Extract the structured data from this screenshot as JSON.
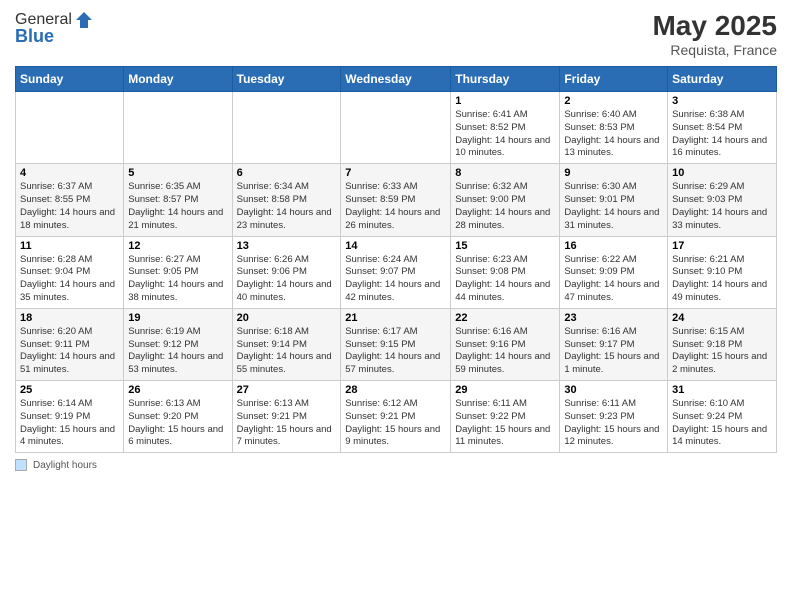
{
  "header": {
    "logo_line1": "General",
    "logo_line2": "Blue",
    "month_year": "May 2025",
    "location": "Requista, France"
  },
  "days_of_week": [
    "Sunday",
    "Monday",
    "Tuesday",
    "Wednesday",
    "Thursday",
    "Friday",
    "Saturday"
  ],
  "weeks": [
    [
      {
        "day": "",
        "sunrise": "",
        "sunset": "",
        "daylight": ""
      },
      {
        "day": "",
        "sunrise": "",
        "sunset": "",
        "daylight": ""
      },
      {
        "day": "",
        "sunrise": "",
        "sunset": "",
        "daylight": ""
      },
      {
        "day": "",
        "sunrise": "",
        "sunset": "",
        "daylight": ""
      },
      {
        "day": "1",
        "sunrise": "Sunrise: 6:41 AM",
        "sunset": "Sunset: 8:52 PM",
        "daylight": "Daylight: 14 hours and 10 minutes."
      },
      {
        "day": "2",
        "sunrise": "Sunrise: 6:40 AM",
        "sunset": "Sunset: 8:53 PM",
        "daylight": "Daylight: 14 hours and 13 minutes."
      },
      {
        "day": "3",
        "sunrise": "Sunrise: 6:38 AM",
        "sunset": "Sunset: 8:54 PM",
        "daylight": "Daylight: 14 hours and 16 minutes."
      }
    ],
    [
      {
        "day": "4",
        "sunrise": "Sunrise: 6:37 AM",
        "sunset": "Sunset: 8:55 PM",
        "daylight": "Daylight: 14 hours and 18 minutes."
      },
      {
        "day": "5",
        "sunrise": "Sunrise: 6:35 AM",
        "sunset": "Sunset: 8:57 PM",
        "daylight": "Daylight: 14 hours and 21 minutes."
      },
      {
        "day": "6",
        "sunrise": "Sunrise: 6:34 AM",
        "sunset": "Sunset: 8:58 PM",
        "daylight": "Daylight: 14 hours and 23 minutes."
      },
      {
        "day": "7",
        "sunrise": "Sunrise: 6:33 AM",
        "sunset": "Sunset: 8:59 PM",
        "daylight": "Daylight: 14 hours and 26 minutes."
      },
      {
        "day": "8",
        "sunrise": "Sunrise: 6:32 AM",
        "sunset": "Sunset: 9:00 PM",
        "daylight": "Daylight: 14 hours and 28 minutes."
      },
      {
        "day": "9",
        "sunrise": "Sunrise: 6:30 AM",
        "sunset": "Sunset: 9:01 PM",
        "daylight": "Daylight: 14 hours and 31 minutes."
      },
      {
        "day": "10",
        "sunrise": "Sunrise: 6:29 AM",
        "sunset": "Sunset: 9:03 PM",
        "daylight": "Daylight: 14 hours and 33 minutes."
      }
    ],
    [
      {
        "day": "11",
        "sunrise": "Sunrise: 6:28 AM",
        "sunset": "Sunset: 9:04 PM",
        "daylight": "Daylight: 14 hours and 35 minutes."
      },
      {
        "day": "12",
        "sunrise": "Sunrise: 6:27 AM",
        "sunset": "Sunset: 9:05 PM",
        "daylight": "Daylight: 14 hours and 38 minutes."
      },
      {
        "day": "13",
        "sunrise": "Sunrise: 6:26 AM",
        "sunset": "Sunset: 9:06 PM",
        "daylight": "Daylight: 14 hours and 40 minutes."
      },
      {
        "day": "14",
        "sunrise": "Sunrise: 6:24 AM",
        "sunset": "Sunset: 9:07 PM",
        "daylight": "Daylight: 14 hours and 42 minutes."
      },
      {
        "day": "15",
        "sunrise": "Sunrise: 6:23 AM",
        "sunset": "Sunset: 9:08 PM",
        "daylight": "Daylight: 14 hours and 44 minutes."
      },
      {
        "day": "16",
        "sunrise": "Sunrise: 6:22 AM",
        "sunset": "Sunset: 9:09 PM",
        "daylight": "Daylight: 14 hours and 47 minutes."
      },
      {
        "day": "17",
        "sunrise": "Sunrise: 6:21 AM",
        "sunset": "Sunset: 9:10 PM",
        "daylight": "Daylight: 14 hours and 49 minutes."
      }
    ],
    [
      {
        "day": "18",
        "sunrise": "Sunrise: 6:20 AM",
        "sunset": "Sunset: 9:11 PM",
        "daylight": "Daylight: 14 hours and 51 minutes."
      },
      {
        "day": "19",
        "sunrise": "Sunrise: 6:19 AM",
        "sunset": "Sunset: 9:12 PM",
        "daylight": "Daylight: 14 hours and 53 minutes."
      },
      {
        "day": "20",
        "sunrise": "Sunrise: 6:18 AM",
        "sunset": "Sunset: 9:14 PM",
        "daylight": "Daylight: 14 hours and 55 minutes."
      },
      {
        "day": "21",
        "sunrise": "Sunrise: 6:17 AM",
        "sunset": "Sunset: 9:15 PM",
        "daylight": "Daylight: 14 hours and 57 minutes."
      },
      {
        "day": "22",
        "sunrise": "Sunrise: 6:16 AM",
        "sunset": "Sunset: 9:16 PM",
        "daylight": "Daylight: 14 hours and 59 minutes."
      },
      {
        "day": "23",
        "sunrise": "Sunrise: 6:16 AM",
        "sunset": "Sunset: 9:17 PM",
        "daylight": "Daylight: 15 hours and 1 minute."
      },
      {
        "day": "24",
        "sunrise": "Sunrise: 6:15 AM",
        "sunset": "Sunset: 9:18 PM",
        "daylight": "Daylight: 15 hours and 2 minutes."
      }
    ],
    [
      {
        "day": "25",
        "sunrise": "Sunrise: 6:14 AM",
        "sunset": "Sunset: 9:19 PM",
        "daylight": "Daylight: 15 hours and 4 minutes."
      },
      {
        "day": "26",
        "sunrise": "Sunrise: 6:13 AM",
        "sunset": "Sunset: 9:20 PM",
        "daylight": "Daylight: 15 hours and 6 minutes."
      },
      {
        "day": "27",
        "sunrise": "Sunrise: 6:13 AM",
        "sunset": "Sunset: 9:21 PM",
        "daylight": "Daylight: 15 hours and 7 minutes."
      },
      {
        "day": "28",
        "sunrise": "Sunrise: 6:12 AM",
        "sunset": "Sunset: 9:21 PM",
        "daylight": "Daylight: 15 hours and 9 minutes."
      },
      {
        "day": "29",
        "sunrise": "Sunrise: 6:11 AM",
        "sunset": "Sunset: 9:22 PM",
        "daylight": "Daylight: 15 hours and 11 minutes."
      },
      {
        "day": "30",
        "sunrise": "Sunrise: 6:11 AM",
        "sunset": "Sunset: 9:23 PM",
        "daylight": "Daylight: 15 hours and 12 minutes."
      },
      {
        "day": "31",
        "sunrise": "Sunrise: 6:10 AM",
        "sunset": "Sunset: 9:24 PM",
        "daylight": "Daylight: 15 hours and 14 minutes."
      }
    ]
  ],
  "legend": {
    "label": "Daylight hours"
  }
}
